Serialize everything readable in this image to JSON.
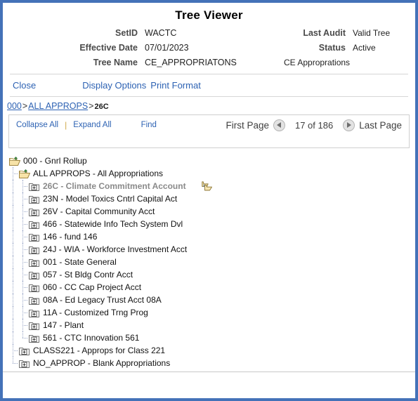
{
  "window": {
    "title": "Tree Viewer",
    "border_color": "#4472b8"
  },
  "header": {
    "fields": [
      {
        "label": "SetID",
        "value": "WACTC"
      },
      {
        "label": "Effective Date",
        "value": "07/01/2023"
      },
      {
        "label": "Tree Name",
        "value": "CE_APPROPRIATONS"
      }
    ],
    "right_fields": [
      {
        "label": "Last Audit",
        "value": "Valid Tree"
      },
      {
        "label": "Status",
        "value": "Active"
      }
    ],
    "tree_description": "CE Approprations"
  },
  "actions": {
    "close": "Close",
    "display_options": "Display Options",
    "print_format": "Print Format"
  },
  "breadcrumb": {
    "root": "000",
    "sep1": ">",
    "level2": "ALL APPROPS",
    "sep2": ">",
    "current": "26C"
  },
  "tree_controls": {
    "collapse_all": "Collapse All",
    "separator": "|",
    "expand_all": "Expand All",
    "find": "Find",
    "first_page": "First Page",
    "page_status": "17 of 186",
    "last_page": "Last Page",
    "prev_icon": "triangle-left-icon",
    "next_icon": "triangle-right-icon"
  },
  "tree": {
    "nodes": [
      {
        "depth": 0,
        "icon": "open-folder-icon",
        "label": "000 - Gnrl Rollup",
        "current": false,
        "last": false,
        "copy": false
      },
      {
        "depth": 1,
        "icon": "open-folder-icon",
        "label": "ALL APPROPS - All Appropriations",
        "current": false,
        "last": false,
        "copy": false
      },
      {
        "depth": 2,
        "icon": "expand-folder-icon",
        "label": "26C - Climate Commitment Account",
        "current": true,
        "last": false,
        "copy": true
      },
      {
        "depth": 2,
        "icon": "expand-folder-icon",
        "label": "23N - Model Toxics Cntrl Capital Act",
        "current": false,
        "last": false,
        "copy": false
      },
      {
        "depth": 2,
        "icon": "expand-folder-icon",
        "label": "26V - Capital Community Acct",
        "current": false,
        "last": false,
        "copy": false
      },
      {
        "depth": 2,
        "icon": "expand-folder-icon",
        "label": "466 - Statewide Info Tech System Dvl",
        "current": false,
        "last": false,
        "copy": false
      },
      {
        "depth": 2,
        "icon": "expand-folder-icon",
        "label": "146 - fund 146",
        "current": false,
        "last": false,
        "copy": false
      },
      {
        "depth": 2,
        "icon": "expand-folder-icon",
        "label": "24J - WIA - Workforce Investment Acct",
        "current": false,
        "last": false,
        "copy": false
      },
      {
        "depth": 2,
        "icon": "expand-folder-icon",
        "label": "001 - State General",
        "current": false,
        "last": false,
        "copy": false
      },
      {
        "depth": 2,
        "icon": "expand-folder-icon",
        "label": "057 - St Bldg Contr Acct",
        "current": false,
        "last": false,
        "copy": false
      },
      {
        "depth": 2,
        "icon": "expand-folder-icon",
        "label": "060 - CC Cap Project Acct",
        "current": false,
        "last": false,
        "copy": false
      },
      {
        "depth": 2,
        "icon": "expand-folder-icon",
        "label": "08A - Ed Legacy Trust Acct 08A",
        "current": false,
        "last": false,
        "copy": false
      },
      {
        "depth": 2,
        "icon": "expand-folder-icon",
        "label": "11A - Customized Trng Prog",
        "current": false,
        "last": false,
        "copy": false
      },
      {
        "depth": 2,
        "icon": "expand-folder-icon",
        "label": "147 - Plant",
        "current": false,
        "last": false,
        "copy": false
      },
      {
        "depth": 2,
        "icon": "expand-folder-icon",
        "label": "561 - CTC Innovation 561",
        "current": false,
        "last": true,
        "copy": false
      },
      {
        "depth": 1,
        "icon": "expand-folder-icon",
        "label": "CLASS221 - Approps for Class 221",
        "current": false,
        "last": false,
        "copy": false
      },
      {
        "depth": 1,
        "icon": "expand-folder-icon",
        "label": "NO_APPROP - Blank Appropriations",
        "current": false,
        "last": true,
        "copy": false
      }
    ]
  }
}
